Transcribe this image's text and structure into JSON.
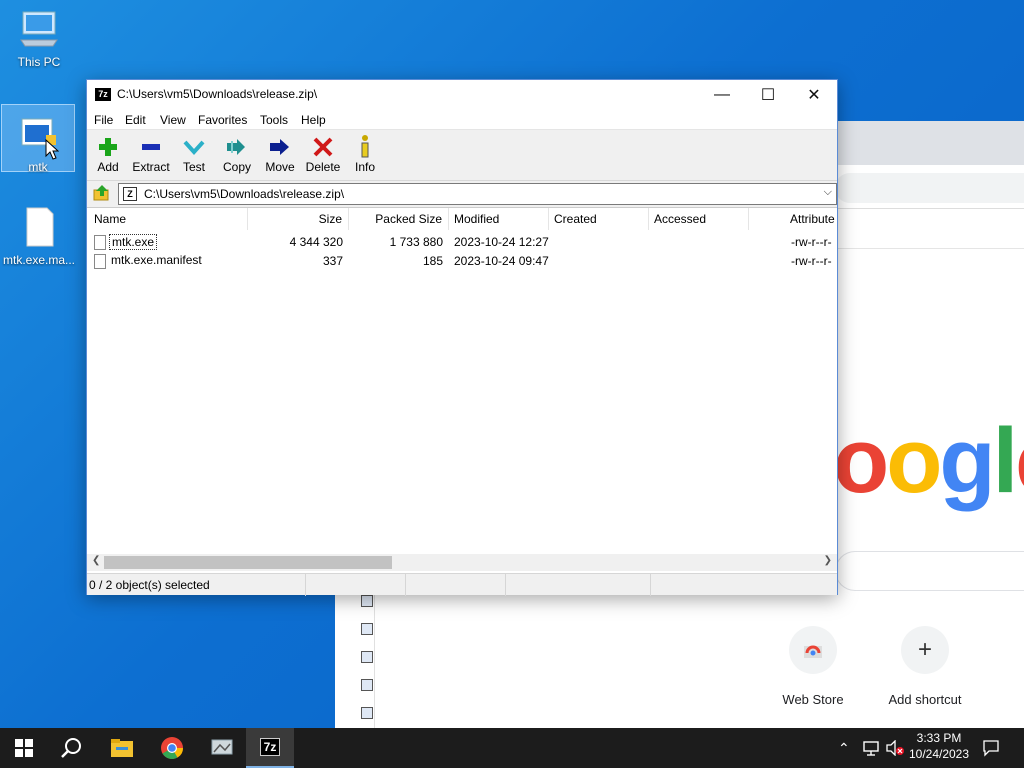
{
  "desktop": {
    "icons": [
      {
        "label": "This PC"
      },
      {
        "label": "mtk"
      },
      {
        "label": "mtk.exe.ma..."
      }
    ]
  },
  "chrome": {
    "logo_letters": [
      "o",
      "o",
      "g",
      "l",
      "e"
    ],
    "shortcuts": [
      {
        "label": "Web Store"
      },
      {
        "label": "Add shortcut",
        "glyph": "+"
      }
    ]
  },
  "window": {
    "title": "C:\\Users\\vm5\\Downloads\\release.zip\\",
    "app_icon_text": "7z",
    "controls": {
      "minimize": "—",
      "maximize": "☐",
      "close": "✕"
    },
    "menu": [
      "File",
      "Edit",
      "View",
      "Favorites",
      "Tools",
      "Help"
    ],
    "toolbar": [
      {
        "label": "Add",
        "icon": "plus-icon",
        "color": "#1aa51a"
      },
      {
        "label": "Extract",
        "icon": "minus-icon",
        "color": "#1a2fb5"
      },
      {
        "label": "Test",
        "icon": "check-icon",
        "color": "#2bb0c8"
      },
      {
        "label": "Copy",
        "icon": "double-arrow-icon",
        "color": "#1f8f8f"
      },
      {
        "label": "Move",
        "icon": "arrow-right-icon",
        "color": "#0b1f8f"
      },
      {
        "label": "Delete",
        "icon": "x-icon",
        "color": "#d01818"
      },
      {
        "label": "Info",
        "icon": "info-icon",
        "color": "#c8a800"
      }
    ],
    "address": "C:\\Users\\vm5\\Downloads\\release.zip\\",
    "columns": [
      "Name",
      "Size",
      "Packed Size",
      "Modified",
      "Created",
      "Accessed",
      "Attribute"
    ],
    "files": [
      {
        "name": "mtk.exe",
        "size": "4 344 320",
        "packed": "1 733 880",
        "modified": "2023-10-24 12:27",
        "created": "",
        "accessed": "",
        "attr": "-rw-r--r-"
      },
      {
        "name": "mtk.exe.manifest",
        "size": "337",
        "packed": "185",
        "modified": "2023-10-24 09:47",
        "created": "",
        "accessed": "",
        "attr": "-rw-r--r-"
      }
    ],
    "status": "0 / 2 object(s) selected"
  },
  "taskbar": {
    "time": "3:33 PM",
    "date": "10/24/2023"
  },
  "colors": {
    "desktop_blue": "#0d6fd1",
    "taskbar": "#1c1c1c",
    "accent": "#5a8bd6"
  }
}
